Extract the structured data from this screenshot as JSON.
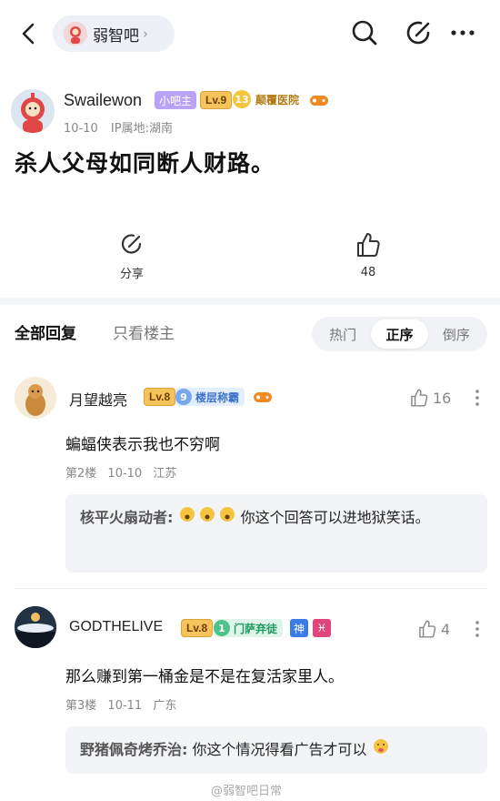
{
  "topbar": {
    "forum_name": "弱智吧",
    "chevron": "›"
  },
  "post": {
    "author": "Swailewon",
    "owner_badge": "小吧主",
    "level": "Lv.9",
    "honor_level": "13",
    "honor_title": "颠覆医院",
    "date": "10-10",
    "ip": "IP属地:湖南",
    "title": "杀人父母如同断人财路。",
    "share_label": "分享",
    "like_count": "48"
  },
  "tabs": {
    "all": "全部回复",
    "op_only": "只看楼主"
  },
  "sort": {
    "options": [
      "热门",
      "正序",
      "倒序"
    ],
    "selected": "正序"
  },
  "replies": [
    {
      "name": "月望越亮",
      "level": "Lv.8",
      "honor_level": "9",
      "honor_title": "楼层称霸",
      "likes": "16",
      "content": "蝙蝠侠表示我也不穷啊",
      "floor": "第2楼",
      "date": "10-10",
      "location": "江苏",
      "sub_reply": {
        "name": "核平火扇动者:",
        "text": "你这个回答可以进地狱笑话。"
      }
    },
    {
      "name": "GODTHELIVE",
      "level": "Lv.8",
      "honor_level": "1",
      "honor_title": "门萨弃徒",
      "tag1": "神",
      "tag2": "♓",
      "likes": "4",
      "content": "那么赚到第一桶金是不是在复活家里人。",
      "floor": "第3楼",
      "date": "10-11",
      "location": "广东",
      "sub_reply": {
        "name": "野猪佩奇烤乔治:",
        "text": "你这个情况得看广告才可以"
      }
    }
  ],
  "watermark": "@弱智吧日常",
  "colors": {
    "owner_badge": "#b9a3f5",
    "level_badge": "#f6c35a",
    "divider": "#f4f5f8"
  }
}
